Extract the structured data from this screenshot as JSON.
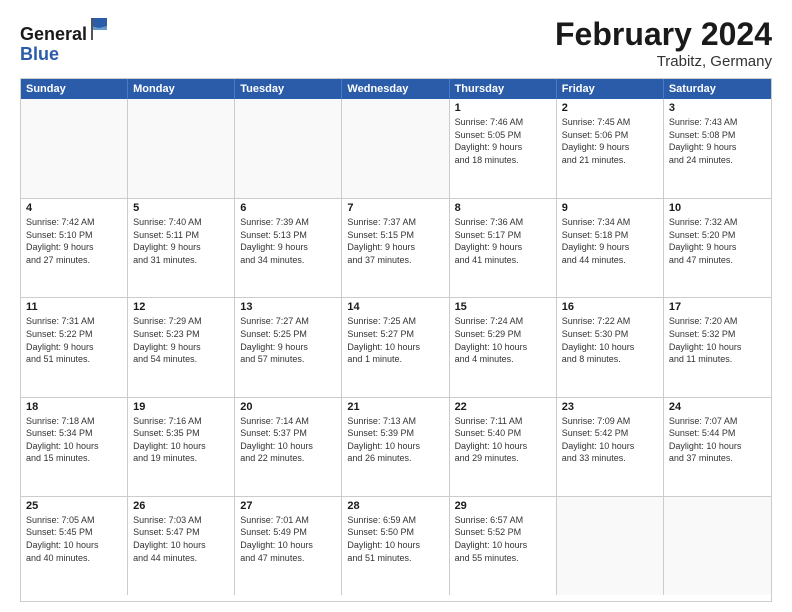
{
  "logo": {
    "general": "General",
    "blue": "Blue"
  },
  "header": {
    "month": "February 2024",
    "location": "Trabitz, Germany"
  },
  "weekdays": [
    "Sunday",
    "Monday",
    "Tuesday",
    "Wednesday",
    "Thursday",
    "Friday",
    "Saturday"
  ],
  "weeks": [
    [
      {
        "day": "",
        "info": ""
      },
      {
        "day": "",
        "info": ""
      },
      {
        "day": "",
        "info": ""
      },
      {
        "day": "",
        "info": ""
      },
      {
        "day": "1",
        "info": "Sunrise: 7:46 AM\nSunset: 5:05 PM\nDaylight: 9 hours\nand 18 minutes."
      },
      {
        "day": "2",
        "info": "Sunrise: 7:45 AM\nSunset: 5:06 PM\nDaylight: 9 hours\nand 21 minutes."
      },
      {
        "day": "3",
        "info": "Sunrise: 7:43 AM\nSunset: 5:08 PM\nDaylight: 9 hours\nand 24 minutes."
      }
    ],
    [
      {
        "day": "4",
        "info": "Sunrise: 7:42 AM\nSunset: 5:10 PM\nDaylight: 9 hours\nand 27 minutes."
      },
      {
        "day": "5",
        "info": "Sunrise: 7:40 AM\nSunset: 5:11 PM\nDaylight: 9 hours\nand 31 minutes."
      },
      {
        "day": "6",
        "info": "Sunrise: 7:39 AM\nSunset: 5:13 PM\nDaylight: 9 hours\nand 34 minutes."
      },
      {
        "day": "7",
        "info": "Sunrise: 7:37 AM\nSunset: 5:15 PM\nDaylight: 9 hours\nand 37 minutes."
      },
      {
        "day": "8",
        "info": "Sunrise: 7:36 AM\nSunset: 5:17 PM\nDaylight: 9 hours\nand 41 minutes."
      },
      {
        "day": "9",
        "info": "Sunrise: 7:34 AM\nSunset: 5:18 PM\nDaylight: 9 hours\nand 44 minutes."
      },
      {
        "day": "10",
        "info": "Sunrise: 7:32 AM\nSunset: 5:20 PM\nDaylight: 9 hours\nand 47 minutes."
      }
    ],
    [
      {
        "day": "11",
        "info": "Sunrise: 7:31 AM\nSunset: 5:22 PM\nDaylight: 9 hours\nand 51 minutes."
      },
      {
        "day": "12",
        "info": "Sunrise: 7:29 AM\nSunset: 5:23 PM\nDaylight: 9 hours\nand 54 minutes."
      },
      {
        "day": "13",
        "info": "Sunrise: 7:27 AM\nSunset: 5:25 PM\nDaylight: 9 hours\nand 57 minutes."
      },
      {
        "day": "14",
        "info": "Sunrise: 7:25 AM\nSunset: 5:27 PM\nDaylight: 10 hours\nand 1 minute."
      },
      {
        "day": "15",
        "info": "Sunrise: 7:24 AM\nSunset: 5:29 PM\nDaylight: 10 hours\nand 4 minutes."
      },
      {
        "day": "16",
        "info": "Sunrise: 7:22 AM\nSunset: 5:30 PM\nDaylight: 10 hours\nand 8 minutes."
      },
      {
        "day": "17",
        "info": "Sunrise: 7:20 AM\nSunset: 5:32 PM\nDaylight: 10 hours\nand 11 minutes."
      }
    ],
    [
      {
        "day": "18",
        "info": "Sunrise: 7:18 AM\nSunset: 5:34 PM\nDaylight: 10 hours\nand 15 minutes."
      },
      {
        "day": "19",
        "info": "Sunrise: 7:16 AM\nSunset: 5:35 PM\nDaylight: 10 hours\nand 19 minutes."
      },
      {
        "day": "20",
        "info": "Sunrise: 7:14 AM\nSunset: 5:37 PM\nDaylight: 10 hours\nand 22 minutes."
      },
      {
        "day": "21",
        "info": "Sunrise: 7:13 AM\nSunset: 5:39 PM\nDaylight: 10 hours\nand 26 minutes."
      },
      {
        "day": "22",
        "info": "Sunrise: 7:11 AM\nSunset: 5:40 PM\nDaylight: 10 hours\nand 29 minutes."
      },
      {
        "day": "23",
        "info": "Sunrise: 7:09 AM\nSunset: 5:42 PM\nDaylight: 10 hours\nand 33 minutes."
      },
      {
        "day": "24",
        "info": "Sunrise: 7:07 AM\nSunset: 5:44 PM\nDaylight: 10 hours\nand 37 minutes."
      }
    ],
    [
      {
        "day": "25",
        "info": "Sunrise: 7:05 AM\nSunset: 5:45 PM\nDaylight: 10 hours\nand 40 minutes."
      },
      {
        "day": "26",
        "info": "Sunrise: 7:03 AM\nSunset: 5:47 PM\nDaylight: 10 hours\nand 44 minutes."
      },
      {
        "day": "27",
        "info": "Sunrise: 7:01 AM\nSunset: 5:49 PM\nDaylight: 10 hours\nand 47 minutes."
      },
      {
        "day": "28",
        "info": "Sunrise: 6:59 AM\nSunset: 5:50 PM\nDaylight: 10 hours\nand 51 minutes."
      },
      {
        "day": "29",
        "info": "Sunrise: 6:57 AM\nSunset: 5:52 PM\nDaylight: 10 hours\nand 55 minutes."
      },
      {
        "day": "",
        "info": ""
      },
      {
        "day": "",
        "info": ""
      }
    ]
  ]
}
